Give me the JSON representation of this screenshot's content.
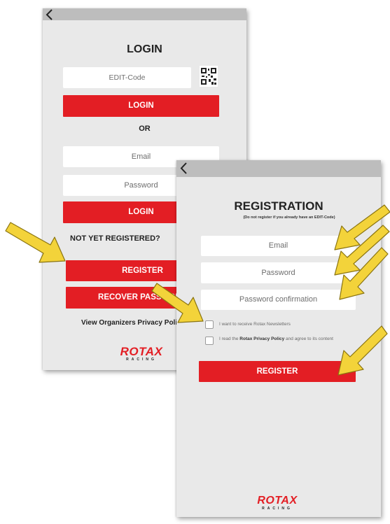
{
  "login_screen": {
    "title": "LOGIN",
    "edit_code_placeholder": "EDIT-Code",
    "qr_icon": "qr-code-icon",
    "login_button_1": "LOGIN",
    "or_label": "OR",
    "email_placeholder": "Email",
    "password_placeholder": "Password",
    "login_button_2": "LOGIN",
    "not_registered_label": "NOT YET REGISTERED?",
    "register_button": "REGISTER",
    "recover_button": "RECOVER PASSWORD",
    "privacy_link": "View Organizers Privacy Policy",
    "logo_text": "ROTAX",
    "logo_subtext": "RACING"
  },
  "registration_screen": {
    "title": "REGISTRATION",
    "subtitle": "(Do not register if you already have an EDIT-Code)",
    "email_placeholder": "Email",
    "password_placeholder": "Password",
    "password_confirm_placeholder": "Password confirmation",
    "newsletter_label": "I want to receive Rotax Newsletters",
    "privacy_label_pre": "I read the ",
    "privacy_label_bold": "Rotax Privacy Policy",
    "privacy_label_post": " and agree to its content",
    "register_button": "REGISTER",
    "logo_text": "ROTAX",
    "logo_subtext": "RACING"
  },
  "colors": {
    "brand_red": "#e31e24",
    "screen_background": "#e9e9e9",
    "top_bar": "#bdbdbd",
    "annotation_arrow": "#f3d33a"
  }
}
